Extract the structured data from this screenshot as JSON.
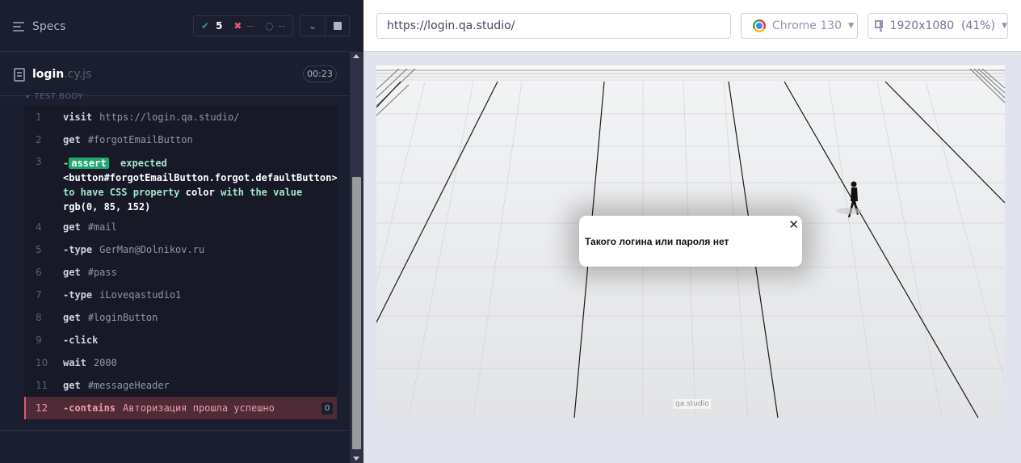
{
  "reporter": {
    "specs_label": "Specs",
    "stats": {
      "passed": "5",
      "failed": "--",
      "pending": "--"
    },
    "spec": {
      "name": "login",
      "ext": ".cy.js",
      "duration": "00:23"
    },
    "section_label": "TEST BODY",
    "commands": [
      {
        "num": "1",
        "name": "visit",
        "msg": "https://login.qa.studio/"
      },
      {
        "num": "2",
        "name": "get",
        "msg": "#forgotEmailButton"
      },
      {
        "num": "3",
        "name": "assert",
        "assert": {
          "p1": "expected",
          "p2": "<button#forgotEmailButton.forgot.defaultButton>",
          "p3": "to have CSS property",
          "p4": "color",
          "p5": "with the value",
          "p6": "rgb(0, 85, 152)"
        }
      },
      {
        "num": "4",
        "name": "get",
        "msg": "#mail"
      },
      {
        "num": "5",
        "name": "type",
        "msg": "GerMan@Dolnikov.ru"
      },
      {
        "num": "6",
        "name": "get",
        "msg": "#pass"
      },
      {
        "num": "7",
        "name": "type",
        "msg": "iLoveqastudio1"
      },
      {
        "num": "8",
        "name": "get",
        "msg": "#loginButton"
      },
      {
        "num": "9",
        "name": "click",
        "msg": ""
      },
      {
        "num": "10",
        "name": "wait",
        "msg": "2000"
      },
      {
        "num": "11",
        "name": "get",
        "msg": "#messageHeader"
      },
      {
        "num": "12",
        "name": "contains",
        "msg": "Авторизация прошла успешно",
        "badge": "0"
      }
    ]
  },
  "aut": {
    "url": "https://login.qa.studio/",
    "browser": "Chrome 130",
    "viewport": "1920x1080",
    "zoom": "(41%)",
    "popup_message": "Такого логина или пароля нет",
    "close_glyph": "✕",
    "watermark": "qa.studio"
  }
}
